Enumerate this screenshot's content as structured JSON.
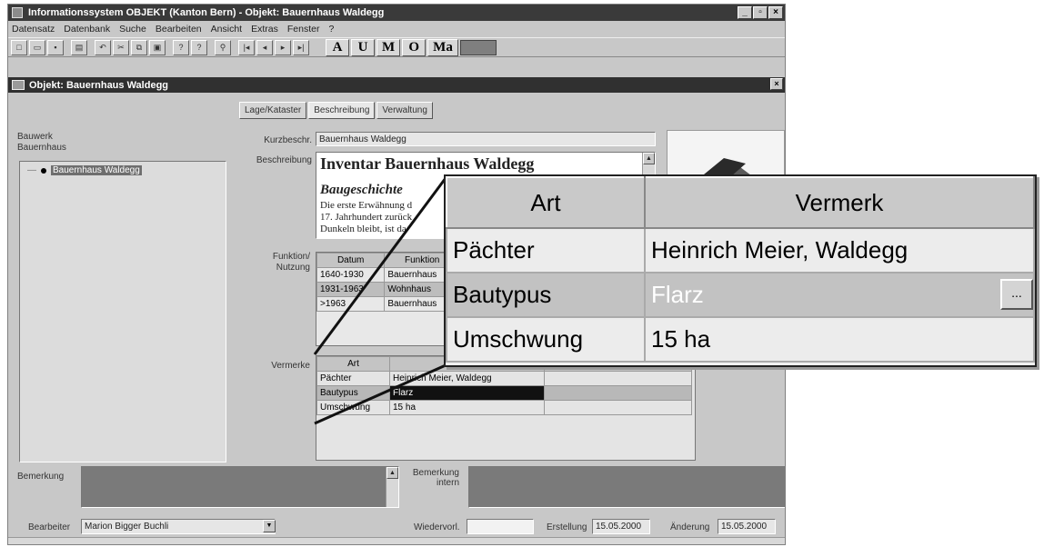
{
  "window": {
    "title": "Informationssystem OBJEKT (Kanton Bern) - Objekt: Bauernhaus Waldegg"
  },
  "menu": [
    "Datensatz",
    "Datenbank",
    "Suche",
    "Bearbeiten",
    "Ansicht",
    "Extras",
    "Fenster",
    "?"
  ],
  "toolbar": {
    "letters": [
      "A",
      "U",
      "M",
      "O",
      "Ma"
    ]
  },
  "child": {
    "title": "Objekt: Bauernhaus Waldegg"
  },
  "tabs": [
    "Lage/Kataster",
    "Beschreibung",
    "Verwaltung"
  ],
  "tree": {
    "heading1": "Bauwerk",
    "heading2": "Bauernhaus",
    "item": "Bauernhaus Waldegg"
  },
  "labels": {
    "kurzbeschr": "Kurzbeschr.",
    "beschreibung": "Beschreibung",
    "funktion": "Funktion/ Nutzung",
    "vermerke": "Vermerke",
    "bemerkung": "Bemerkung",
    "bemerkung_intern": "Bemerkung intern",
    "bearbeiter": "Bearbeiter",
    "wiedervorl": "Wiedervorl.",
    "erstellung": "Erstellung",
    "aenderung": "Änderung"
  },
  "fields": {
    "kurzbeschr": "Bauernhaus Waldegg",
    "bearbeiter": "Marion Bigger Buchli",
    "erstellung": "15.05.2000",
    "aenderung": "15.05.2000"
  },
  "description": {
    "title": "Inventar Bauernhaus Waldegg",
    "subtitle": "Baugeschichte",
    "line1": "Die erste Erwähnung d",
    "line2": "17. Jahrhundert zurück",
    "line3": "Dunkeln bleibt, ist da"
  },
  "funktion": {
    "headers": [
      "Datum",
      "Funktion"
    ],
    "rows": [
      [
        "1640-1930",
        "Bauernhaus"
      ],
      [
        "1931-1963",
        "Wohnhaus"
      ],
      [
        ">1963",
        "Bauernhaus"
      ]
    ]
  },
  "vermerke": {
    "headers": [
      "Art",
      "Vermerk"
    ],
    "rows": [
      [
        "Pächter",
        "Heinrich Meier, Waldegg"
      ],
      [
        "Bautypus",
        "Flarz"
      ],
      [
        "Umschwung",
        "15 ha"
      ]
    ]
  },
  "zoom": {
    "headers": [
      "Art",
      "Vermerk"
    ],
    "rows": [
      [
        "Pächter",
        "Heinrich Meier, Waldegg"
      ],
      [
        "Bautypus",
        "Flarz"
      ],
      [
        "Umschwung",
        "15 ha"
      ]
    ],
    "ellipsis": "..."
  }
}
